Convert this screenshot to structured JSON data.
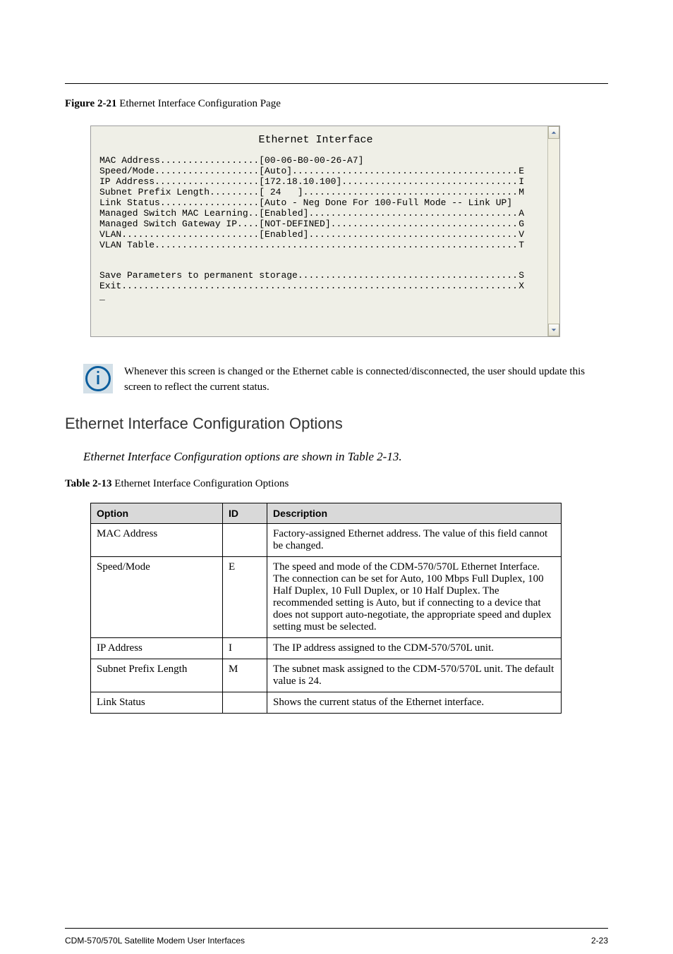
{
  "header": {
    "figure_label": "Figure 2-21",
    "figure_title": " Ethernet Interface Configuration Page"
  },
  "terminal": {
    "title": "Ethernet Interface",
    "rows": [
      {
        "left": "MAC Address..................[00-06-B0-00-26-A7]",
        "right": ""
      },
      {
        "left": "Speed/Mode...................[Auto]",
        "right": "E"
      },
      {
        "left": "IP Address...................[172.18.10.100]",
        "right": "I"
      },
      {
        "left": "Subnet Prefix Length.........[ 24   ]",
        "right": "M"
      },
      {
        "left": "Link Status..................[Auto - Neg Done For 100-Full Mode -- Link UP]",
        "right": ""
      },
      {
        "left": "Managed Switch MAC Learning..[Enabled]",
        "right": "A"
      },
      {
        "left": "Managed Switch Gateway IP....[NOT-DEFINED]",
        "right": "G"
      },
      {
        "left": "VLAN.........................[Enabled]",
        "right": "V"
      },
      {
        "left": "VLAN Table",
        "right": "T"
      }
    ],
    "footer_rows": [
      {
        "left": "Save Parameters to permanent storage",
        "right": "S"
      },
      {
        "left": "Exit",
        "right": "X"
      }
    ],
    "cursor": "_"
  },
  "note": {
    "text": "Whenever this screen is changed or the Ethernet cable is connected/disconnected, the user should update this screen to reflect the current status."
  },
  "section": {
    "title": "Ethernet Interface Configuration Options",
    "subtitle": "Ethernet Interface Configuration options are shown in Table 2-13.",
    "table_caption_label": "Table 2-13",
    "table_caption_title": "  Ethernet Interface Configuration Options"
  },
  "table": {
    "headers": [
      "Option",
      "ID",
      "Description"
    ],
    "rows": [
      {
        "option": "MAC Address",
        "id": "",
        "desc": "Factory-assigned Ethernet address. The value of this field cannot be changed."
      },
      {
        "option": "Speed/Mode",
        "id": "E",
        "desc": "The speed and mode of the CDM-570/570L Ethernet Interface. The connection can be set for Auto, 100 Mbps Full Duplex, 100 Half Duplex, 10 Full Duplex, or 10 Half Duplex. The recommended setting is Auto, but if connecting to a device that does not support auto-negotiate, the appropriate speed and duplex setting must be selected."
      },
      {
        "option": "IP Address",
        "id": "I",
        "desc": "The IP address assigned to the CDM-570/570L unit."
      },
      {
        "option": "Subnet Prefix Length",
        "id": "M",
        "desc": "The subnet mask assigned to the CDM-570/570L unit. The default value is 24."
      },
      {
        "option": "Link Status",
        "id": "",
        "desc": "Shows the current status of the Ethernet interface."
      }
    ]
  },
  "footer": {
    "left": "CDM-570/570L Satellite Modem User Interfaces",
    "right": "2-23"
  }
}
